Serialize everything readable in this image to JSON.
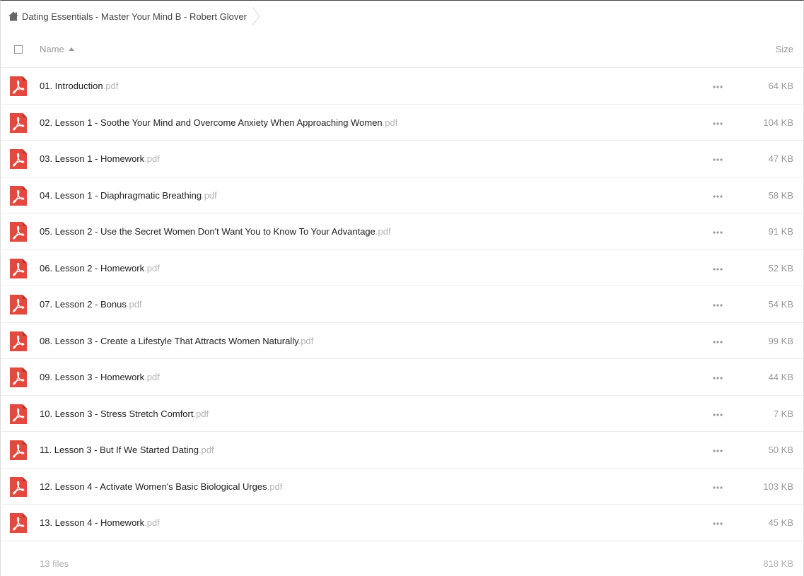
{
  "breadcrumb": {
    "home_icon": "home-icon",
    "path": "Dating Essentials - Master Your Mind B - Robert Glover"
  },
  "table_header": {
    "name_label": "Name",
    "size_label": "Size",
    "sort": "ascending"
  },
  "files": [
    {
      "name": "01. Introduction",
      "ext": ".pdf",
      "size": "64 KB",
      "icon": "pdf-icon"
    },
    {
      "name": "02. Lesson 1 - Soothe Your Mind and Overcome Anxiety When Approaching Women",
      "ext": ".pdf",
      "size": "104 KB",
      "icon": "pdf-icon"
    },
    {
      "name": "03. Lesson 1 - Homework",
      "ext": ".pdf",
      "size": "47 KB",
      "icon": "pdf-icon"
    },
    {
      "name": "04. Lesson 1 - Diaphragmatic Breathing",
      "ext": ".pdf",
      "size": "58 KB",
      "icon": "pdf-icon"
    },
    {
      "name": "05. Lesson 2 - Use the Secret Women Don't Want You to Know To Your Advantage",
      "ext": ".pdf",
      "size": "91 KB",
      "icon": "pdf-icon"
    },
    {
      "name": "06. Lesson 2 - Homework",
      "ext": ".pdf",
      "size": "52 KB",
      "icon": "pdf-icon"
    },
    {
      "name": "07. Lesson 2 - Bonus",
      "ext": ".pdf",
      "size": "54 KB",
      "icon": "pdf-icon"
    },
    {
      "name": "08. Lesson 3 - Create a Lifestyle That Attracts Women Naturally",
      "ext": ".pdf",
      "size": "99 KB",
      "icon": "pdf-icon"
    },
    {
      "name": "09. Lesson 3 - Homework",
      "ext": ".pdf",
      "size": "44 KB",
      "icon": "pdf-icon"
    },
    {
      "name": "10. Lesson 3 - Stress Stretch Comfort",
      "ext": ".pdf",
      "size": "7 KB",
      "icon": "pdf-icon"
    },
    {
      "name": "11. Lesson 3 - But If We Started Dating",
      "ext": ".pdf",
      "size": "50 KB",
      "icon": "pdf-icon"
    },
    {
      "name": "12. Lesson 4 - Activate Women's Basic Biological Urges",
      "ext": ".pdf",
      "size": "103 KB",
      "icon": "pdf-icon"
    },
    {
      "name": "13. Lesson 4 - Homework",
      "ext": ".pdf",
      "size": "45 KB",
      "icon": "pdf-icon"
    }
  ],
  "footer": {
    "file_count": "13 files",
    "total_size": "818 KB"
  },
  "colors": {
    "pdf_red": "#e2493f",
    "muted_text": "#999999",
    "ext_text": "#b3b3b3",
    "row_border": "#ececec"
  }
}
